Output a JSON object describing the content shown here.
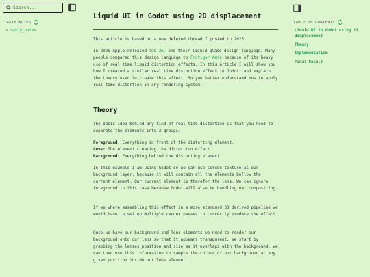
{
  "sidebar": {
    "search_placeholder": "Search...",
    "section_label": "TASTY NOTES",
    "items": [
      {
        "label": "tasty_notes"
      }
    ]
  },
  "article": {
    "title": "Liquid UI in Godot using 2D displacement",
    "p1": "This article is based on a now deleted thread I posted in 2025.",
    "p2_a": "In 2025 Apple released ",
    "p2_link1": "iOS 26",
    "p2_b": " and their liquid glass design language. Many people compared this design language to ",
    "p2_link2": "Frutiger Aero",
    "p2_c": " because of its heavy use of real time liquid distortion effects. In this article I will show you how I created a similar real time distortion effect in Godot; and explain the theory used to create this effect. So you better understand how to apply real time distortion in any rendering system.",
    "theory_heading": "Theory",
    "p3": "The basic idea behind any kind of real time distortion is that you need to separate the elements into 3 groups.",
    "fg_term": "Foreground:",
    "fg_desc": " Everything in front of the distorting element.",
    "lens_term": "Lens:",
    "lens_desc": " The element creating the distortion effect.",
    "bg_term": "Background:",
    "bg_desc": " Everything behind the distorting element.",
    "p4": "In this example I am using Godot so we can use screen texture as our background layer; because it will contain all the elements bellow the current element. Our current element is therefor the lens. We can ignore foreground in this case because Godot will also be handling our compositing.",
    "p5": "If we where assembling this effect in a more standard 3D derived pipeline we would have to set up multiple render passes to correctly produce the effect.",
    "p6": "Once we have our background and lens elements we need to render our background onto our lens so that it appears transparent. We start by grabbing the lenses position and size as it overlaps with the background. we can then use this information to sample the colour of our background at any given position inside our lens element."
  },
  "toc": {
    "label": "TABLE OF CONTENTS",
    "items": [
      {
        "label": "Liquid UI in Godot using 2D displacement"
      },
      {
        "label": "Theory"
      },
      {
        "label": "Implementation"
      },
      {
        "label": "Final Result"
      }
    ]
  },
  "colors": {
    "background": "#dcf5cf",
    "accent": "#1f9a58",
    "text": "#2b2b2b"
  }
}
